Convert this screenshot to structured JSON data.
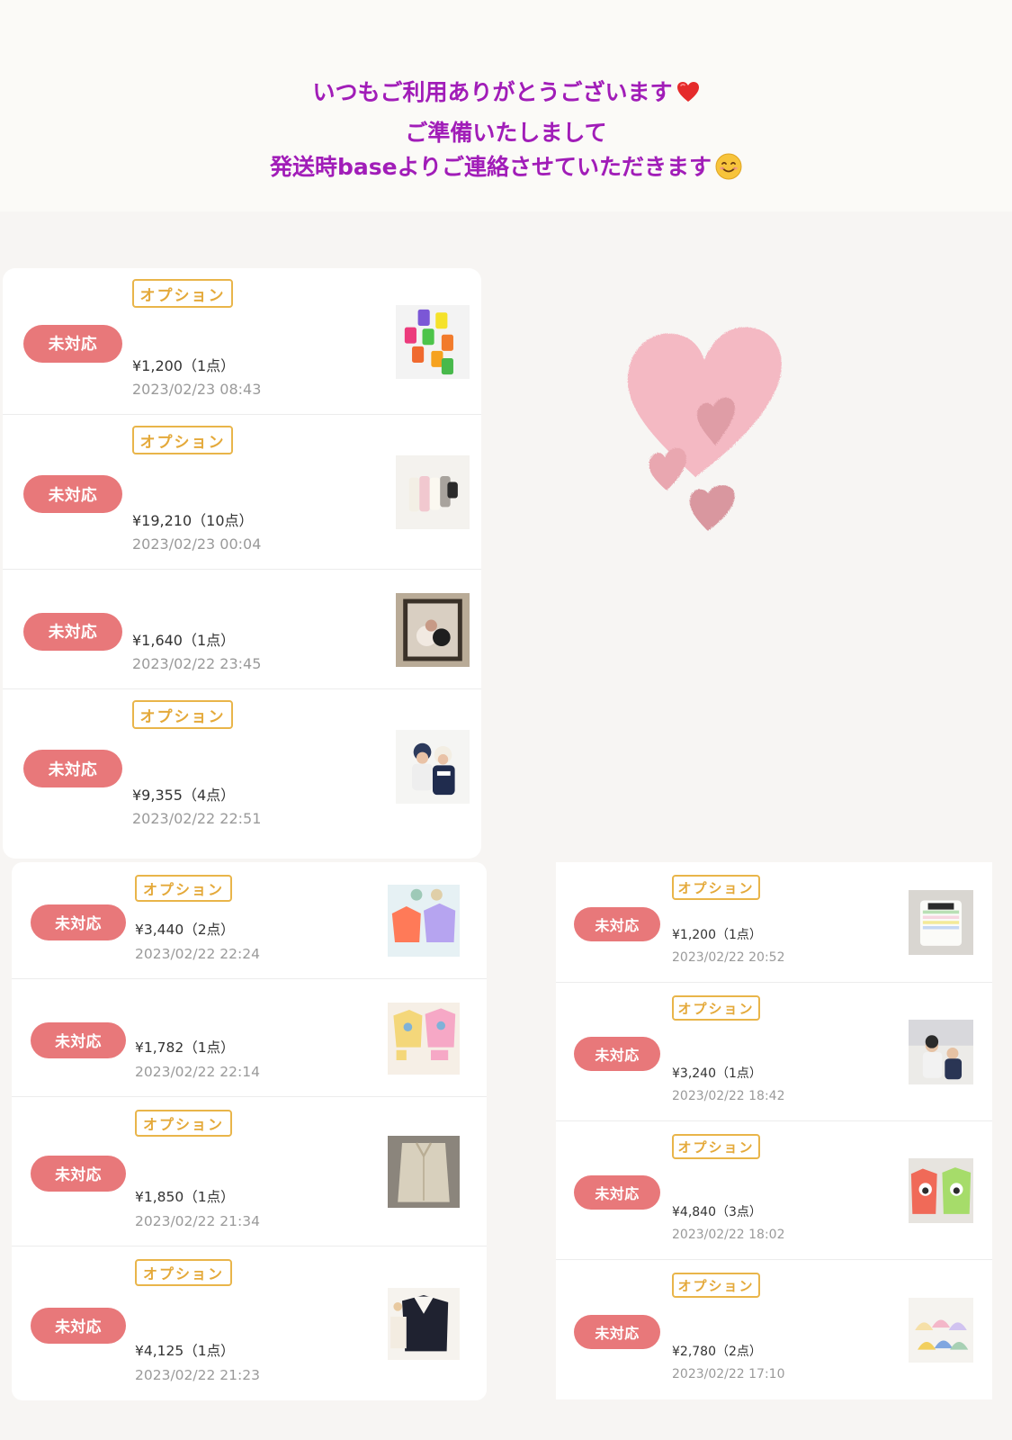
{
  "header": {
    "line1": "いつもご利用ありがとうございます",
    "line2": "ご準備いたしまして",
    "line3": "発送時baseよりご連絡させていただきます"
  },
  "colors": {
    "status": "#e8787a",
    "option": "#e9b54a",
    "message": "#a11db8"
  },
  "icons": [
    "red-heart-emoji-icon",
    "smiling-face-emoji-icon",
    "pink-hearts-illustration"
  ],
  "orders_a": [
    {
      "status": "未対応",
      "option": "オプション",
      "price": "¥1,200（1点）",
      "date": "2023/02/23 08:43"
    },
    {
      "status": "未対応",
      "option": "オプション",
      "price": "¥19,210（10点）",
      "date": "2023/02/23 00:04"
    },
    {
      "status": "未対応",
      "option": "",
      "price": "¥1,640（1点）",
      "date": "2023/02/22 23:45"
    },
    {
      "status": "未対応",
      "option": "オプション",
      "price": "¥9,355（4点）",
      "date": "2023/02/22 22:51"
    }
  ],
  "orders_b": [
    {
      "status": "未対応",
      "option": "オプション",
      "price": "¥3,440（2点）",
      "date": "2023/02/22 22:24"
    },
    {
      "status": "未対応",
      "option": "",
      "price": "¥1,782（1点）",
      "date": "2023/02/22 22:14"
    },
    {
      "status": "未対応",
      "option": "オプション",
      "price": "¥1,850（1点）",
      "date": "2023/02/22 21:34"
    },
    {
      "status": "未対応",
      "option": "オプション",
      "price": "¥4,125（1点）",
      "date": "2023/02/22 21:23"
    }
  ],
  "orders_c": [
    {
      "status": "未対応",
      "option": "オプション",
      "price": "¥1,200（1点）",
      "date": "2023/02/22 20:52"
    },
    {
      "status": "未対応",
      "option": "オプション",
      "price": "¥3,240（1点）",
      "date": "2023/02/22 18:42"
    },
    {
      "status": "未対応",
      "option": "オプション",
      "price": "¥4,840（3点）",
      "date": "2023/02/22 18:02"
    },
    {
      "status": "未対応",
      "option": "オプション",
      "price": "¥2,780（2点）",
      "date": "2023/02/22 17:10"
    }
  ]
}
